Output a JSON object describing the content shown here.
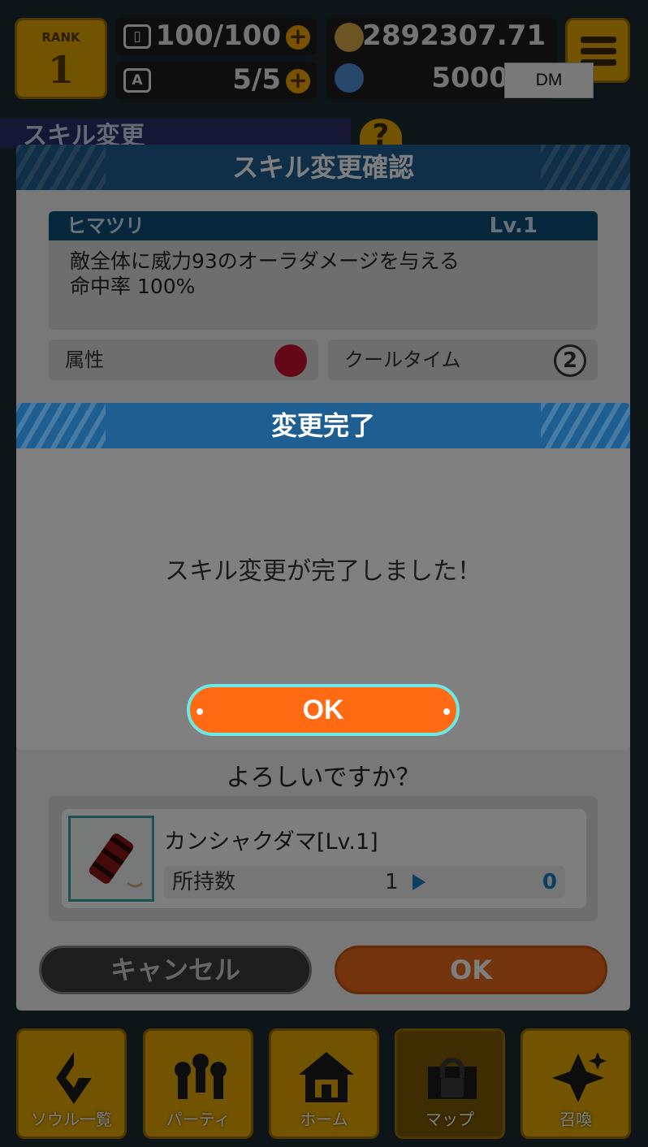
{
  "hud": {
    "rank_label": "RANK",
    "rank_value": "1",
    "stamina": "100/100",
    "stamina_icon": "battery-icon",
    "ap": "5/5",
    "ap_icon": "ap-icon",
    "gold": "2892307.71",
    "gems": "5000",
    "dm_badge": "DM"
  },
  "section_title": "スキル変更",
  "confirm_panel": {
    "title": "スキル変更確認",
    "skill": {
      "name": "ヒマツリ",
      "level": "Lv.1",
      "description": "敵全体に威力93のオーラダメージを与える\n命中率 100%"
    },
    "attribute_label": "属性",
    "cooltime_label": "クールタイム",
    "cooltime_value": "2",
    "question": "よろしいですか？",
    "item": {
      "name": "カンシャクダマ[Lv.1]",
      "hold_label": "所持数",
      "hold_from": "1",
      "hold_to": "0"
    },
    "cancel_label": "キャンセル",
    "ok_label": "OK"
  },
  "dialog": {
    "title": "変更完了",
    "message": "スキル変更が完了しました！",
    "ok_label": "OK"
  },
  "nav": [
    {
      "label": "ソウル一覧",
      "icon": "soul-list-icon"
    },
    {
      "label": "パーティ",
      "icon": "party-icon"
    },
    {
      "label": "ホーム",
      "icon": "home-icon"
    },
    {
      "label": "マップ",
      "icon": "map-locked-icon"
    },
    {
      "label": "召喚",
      "icon": "summon-icon"
    }
  ],
  "colors": {
    "header_blue": "#1f5e90",
    "accent_orange": "#ff6a12",
    "ok_border": "#6be9e4",
    "nav_gold": "#e2a700"
  }
}
